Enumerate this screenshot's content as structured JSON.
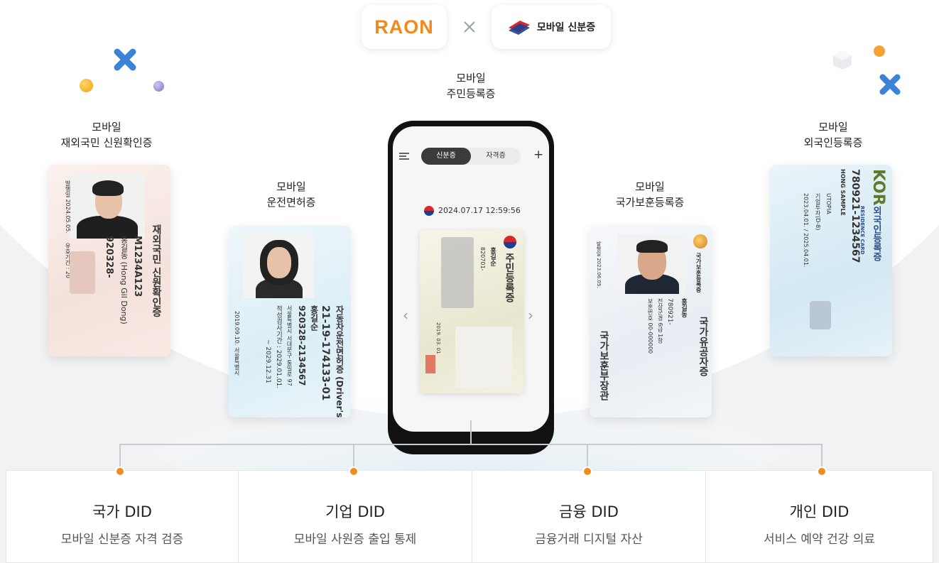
{
  "header": {
    "raon_logo": "RAON",
    "separator": "×",
    "partner_logo": "모바일 신분증"
  },
  "center_caption": {
    "line1": "모바일",
    "line2": "주민등록증"
  },
  "captions": [
    {
      "line1": "모바일",
      "line2": "재외국민 신원확인증"
    },
    {
      "line1": "모바일",
      "line2": "운전면허증"
    },
    {
      "line1": "모바일",
      "line2": "국가보훈등록증"
    },
    {
      "line1": "모바일",
      "line2": "외국인등록증"
    }
  ],
  "phone": {
    "tab_active": "신분증",
    "tab_inactive": "자격증",
    "plus": "+",
    "datetime": "2024.07.17  12:59:56",
    "card_title": "주민등록증",
    "card_name": "홍길순",
    "card_number": "820701-",
    "card_date": "2019. 03. 01"
  },
  "cards": {
    "overseas": {
      "title": "재외국민 신원확인증",
      "number": "M1234A123",
      "name": "홍길동 (Hong Gil Dong)",
      "birth": "920328-",
      "issued": "발행일 2024.05.05.",
      "valid": "유효기간 : 20"
    },
    "driver": {
      "title": "자동차운전면허증 (Driver's License)",
      "number": "21-19-174133-01",
      "name": "홍길순",
      "id": "920328-2134567",
      "address": "서울특별시 서대문구 통일로 97",
      "valid": "적성검사기간 : 2029.01.01.",
      "valid2": "~ 2029.12.31",
      "issued": "2019.09.10.  서울특별시"
    },
    "veteran": {
      "title": "국가유공자증",
      "org": "국가보훈등록증",
      "name": "홍길동",
      "id": "780921-",
      "rank": "전상군경 6급 1항",
      "reg": "보훈번호 00-000000",
      "issuer": "국가보훈부장관",
      "issued": "발행일 2023.06.05."
    },
    "foreign": {
      "title": "외국인등록증",
      "subtitle": "RESIDENCE CARD",
      "country": "KOR",
      "number": "780921-1234567",
      "name": "HONG SAMPLE",
      "nationality": "UTOPIA",
      "status": "기업투자(D-8)",
      "period": "2023.04.01. / 2025.04.01."
    }
  },
  "panels": [
    {
      "title": "국가 DID",
      "subtitle": "모바일 신분증 자격 검증"
    },
    {
      "title": "기업 DID",
      "subtitle": "모바일 사원증 출입 통제"
    },
    {
      "title": "금융 DID",
      "subtitle": "금융거래 디지털 자산"
    },
    {
      "title": "개인 DID",
      "subtitle": "서비스 예약 건강 의료"
    }
  ],
  "colors": {
    "accent": "#f28c1e",
    "raon": "#f08a1c",
    "tab_active": "#3b3b3b",
    "background": "#f1f2f4"
  }
}
